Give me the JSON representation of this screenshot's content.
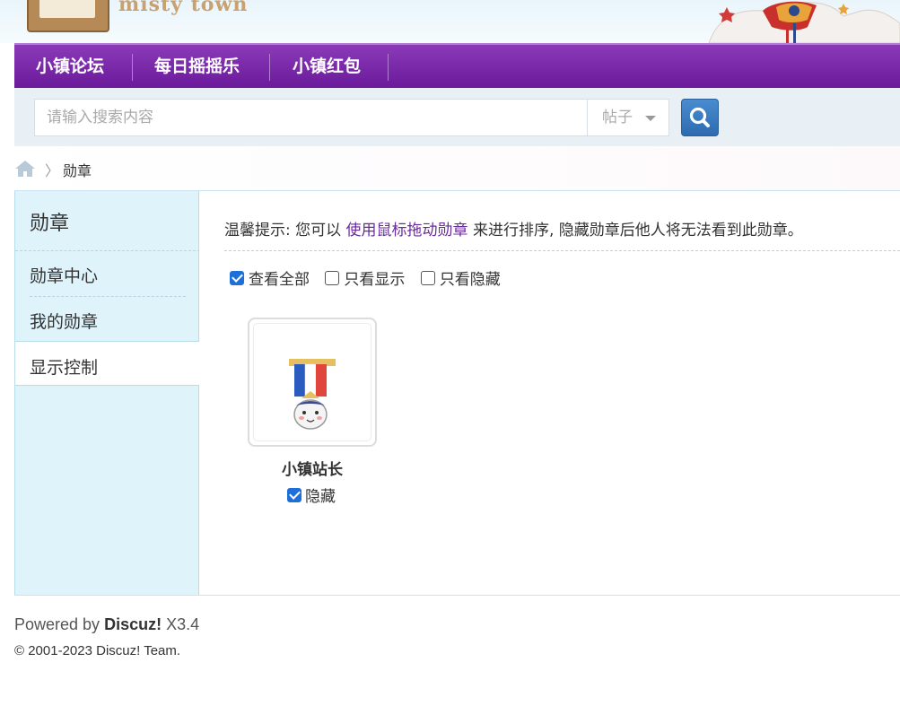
{
  "header": {
    "logo_text": "misty town",
    "nav": [
      "小镇论坛",
      "每日摇摇乐",
      "小镇红包"
    ]
  },
  "search": {
    "placeholder": "请输入搜索内容",
    "type_label": "帖子"
  },
  "breadcrumb": {
    "current": "勋章"
  },
  "sidebar": {
    "title": "勋章",
    "items": [
      "勋章中心",
      "我的勋章",
      "显示控制"
    ],
    "active_index": 2
  },
  "main": {
    "tip_prefix": "温馨提示: 您可以",
    "tip_link": "使用鼠标拖动勋章",
    "tip_suffix": "来进行排序, 隐藏勋章后他人将无法看到此勋章。",
    "filters": [
      {
        "label": "查看全部",
        "checked": true
      },
      {
        "label": "只看显示",
        "checked": false
      },
      {
        "label": "只看隐藏",
        "checked": false
      }
    ],
    "medals": [
      {
        "name": "小镇站长",
        "hide_label": "隐藏",
        "hidden": true
      }
    ]
  },
  "footer": {
    "powered_prefix": "Powered by",
    "brand": "Discuz!",
    "version": "X3.4",
    "copyright": "© 2001-2023 Discuz! Team."
  },
  "colors": {
    "nav_bg": "#7a2aaa",
    "link": "#6a2a9a",
    "sidebar_bg": "#dff3fb",
    "checkbox_on": "#1f6fd8",
    "search_button": "#3a7cc2"
  }
}
